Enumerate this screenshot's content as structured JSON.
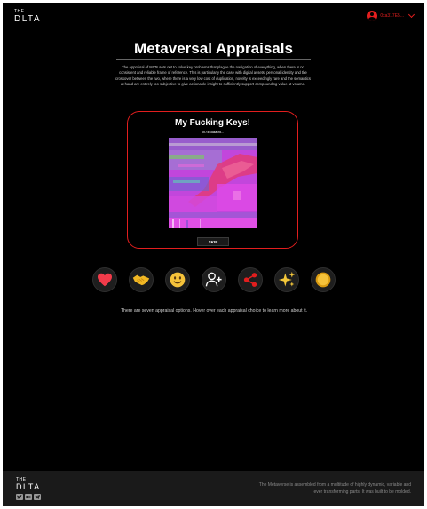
{
  "header": {
    "logo_the": "THE",
    "logo_dlta": "DLTA",
    "account_label": "0xa317E5..."
  },
  "main": {
    "title": "Metaversal Appraisals",
    "intro": "The appraisal of NFTs sets out to solve key problems that plague the navigation of everything, when there is no consistent and reliable frame of reference. This is particularly the case with digital assets, personal identity and the crossover between the two, where there is a very low cost of duplication, novelty is exceedingly rare and the semantics at hand are entirely too subjective to give actionable insight to sufficiently support compounding value at volume.",
    "card": {
      "title": "My Fucking Keys!",
      "address": "0x7465aa9d...",
      "skip_label": "SKIP"
    },
    "options": [
      {
        "name": "heart-icon",
        "glyph": "❤"
      },
      {
        "name": "handshake-icon",
        "glyph": "🤝"
      },
      {
        "name": "smile-icon",
        "glyph": "☺"
      },
      {
        "name": "add-person-icon",
        "glyph": "+"
      },
      {
        "name": "share-icon",
        "glyph": "⋯"
      },
      {
        "name": "sparkles-icon",
        "glyph": "✨"
      },
      {
        "name": "coin-icon",
        "glyph": "●"
      }
    ],
    "hint": "There are seven appraisal options. Hover over each appraisal choice to learn more about it."
  },
  "footer": {
    "logo_the": "THE",
    "logo_dlta": "DLTA",
    "socials": [
      "twitter-icon",
      "medium-icon",
      "telegram-icon"
    ],
    "text": "The Metaverse is assembled from a multitude of highly dynamic, variable and ever transforming parts. It was built to be molded."
  },
  "colors": {
    "accent": "#e21e1e",
    "background": "#000000",
    "footer": "#1a1a1a"
  }
}
